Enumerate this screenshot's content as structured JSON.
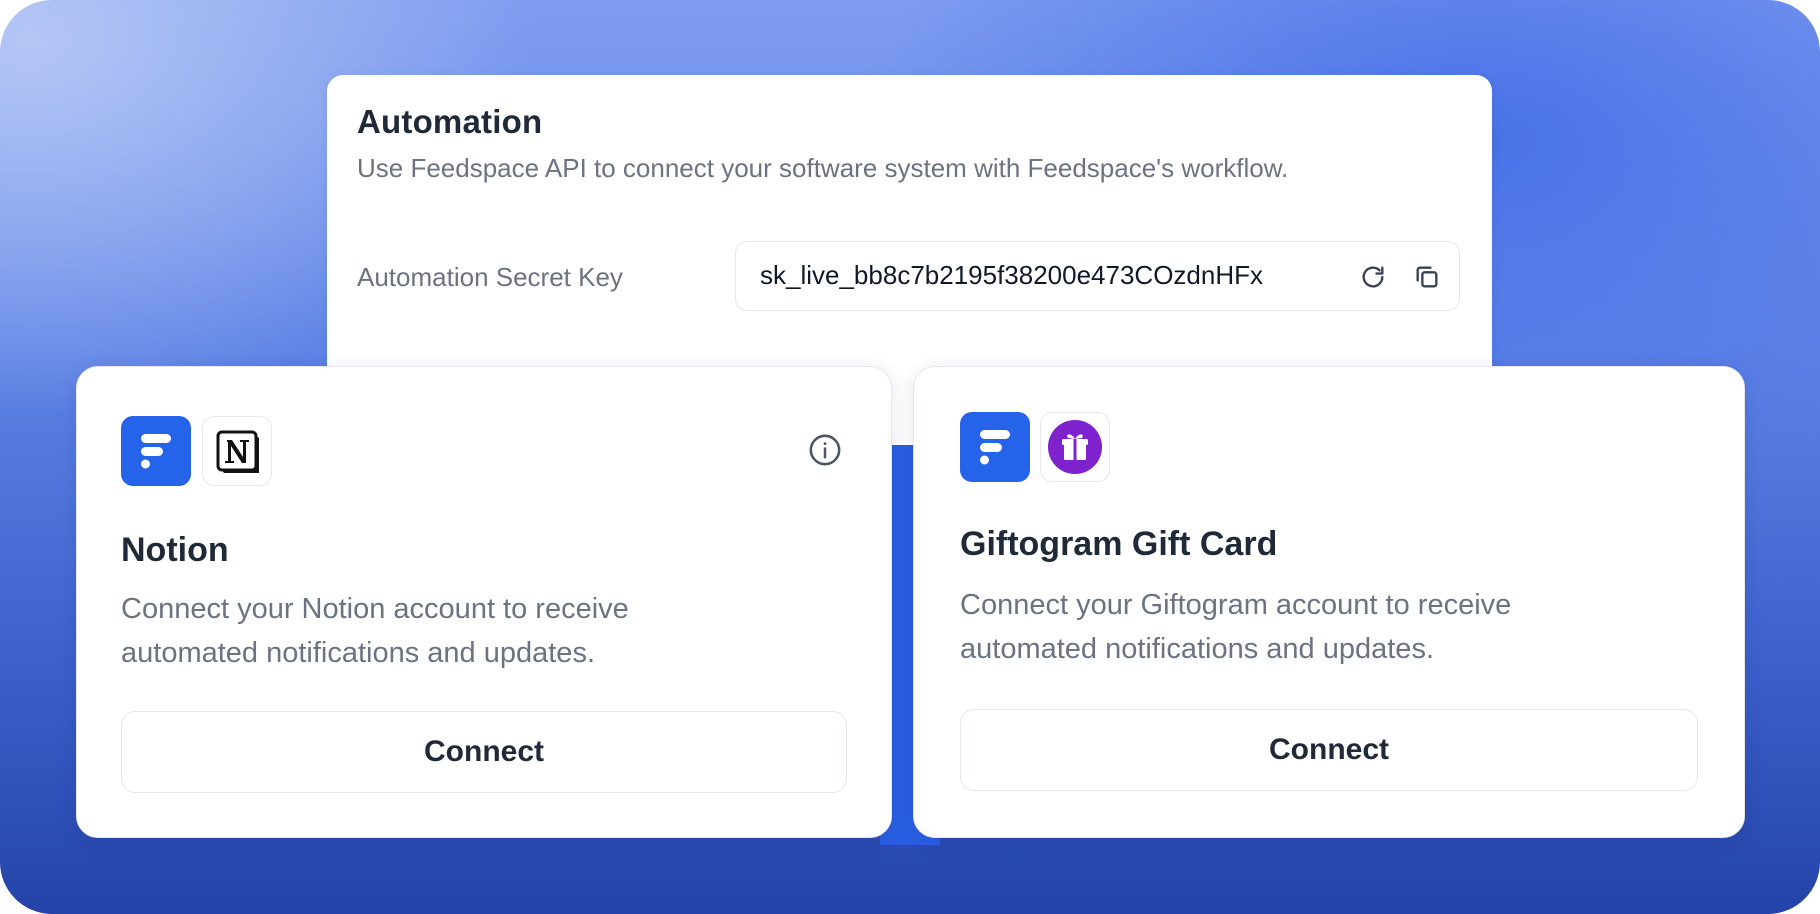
{
  "automation": {
    "title": "Automation",
    "description": "Use Feedspace API to connect your software system with Feedspace's workflow.",
    "secret_key_label": "Automation Secret Key",
    "secret_key_value": "sk_live_bb8c7b2195f38200e473COzdnHFx",
    "refresh_icon": "refresh-icon",
    "copy_icon": "copy-icon"
  },
  "integrations": [
    {
      "name": "Notion",
      "description_line1": "Connect your Notion account to receive",
      "description_line2": "automated notifications and updates.",
      "connect_label": "Connect",
      "logos": [
        "feedspace-logo",
        "notion-logo"
      ],
      "has_info_icon": true
    },
    {
      "name": "Giftogram Gift Card",
      "description_line1": "Connect your Giftogram account to receive",
      "description_line2": "automated notifications and updates.",
      "connect_label": "Connect",
      "logos": [
        "feedspace-logo",
        "giftogram-logo"
      ],
      "has_info_icon": false
    }
  ],
  "colors": {
    "feedspace_blue": "#2563eb",
    "giftogram_purple": "#7e22ce",
    "heading": "#1f2937",
    "muted_text": "#6b7280"
  }
}
